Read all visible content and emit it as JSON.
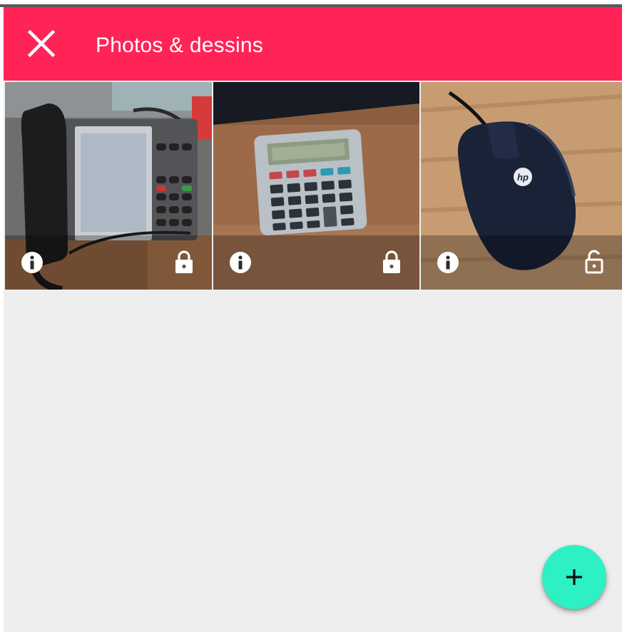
{
  "appbar": {
    "title": "Photos & dessins",
    "close_icon": "close-icon",
    "color": "#ff2357"
  },
  "photos": [
    {
      "subject": "desk phone",
      "info_icon": "info-icon",
      "lock_icon": "lock-closed-icon",
      "locked": true
    },
    {
      "subject": "calculator",
      "info_icon": "info-icon",
      "lock_icon": "lock-closed-icon",
      "locked": true
    },
    {
      "subject": "computer mouse",
      "info_icon": "info-icon",
      "lock_icon": "lock-open-icon",
      "locked": false,
      "mouse_brand_text": "hp"
    }
  ],
  "fab": {
    "icon": "plus-icon",
    "color": "#2df0c4"
  },
  "colors": {
    "background": "#eeeeee",
    "overlay": "rgba(0,0,0,0.28)"
  }
}
